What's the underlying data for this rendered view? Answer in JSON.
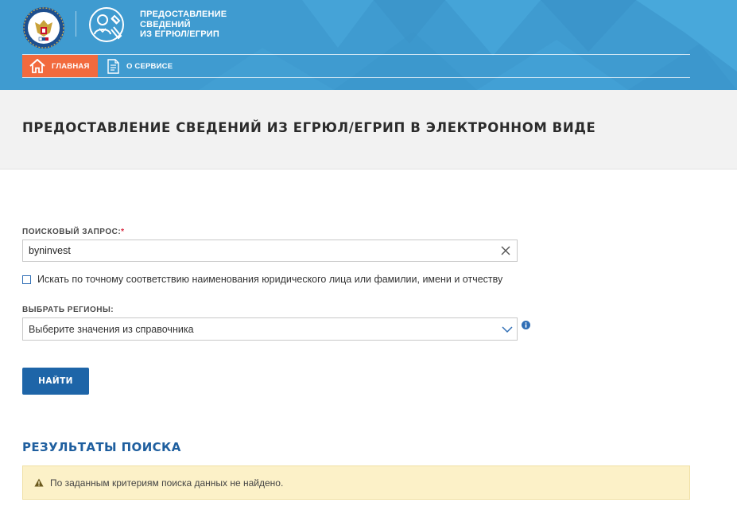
{
  "header": {
    "service_title_lines": [
      "ПРЕДОСТАВЛЕНИЕ",
      "СВЕДЕНИЙ",
      "ИЗ ЕГРЮЛ/ЕГРИП"
    ],
    "nav": {
      "home_label": "ГЛАВНАЯ",
      "about_label": "О СЕРВИСЕ",
      "active": "home"
    }
  },
  "page": {
    "title": "ПРЕДОСТАВЛЕНИЕ СВЕДЕНИЙ ИЗ ЕГРЮЛ/ЕГРИП В ЭЛЕКТРОННОМ ВИДЕ"
  },
  "form": {
    "query_label": "ПОИСКОВЫЙ ЗАПРОС:",
    "required_mark": "*",
    "query_value": "byninvest",
    "exact_match_label": "Искать по точному соответствию наименования юридического лица или фамилии, имени и отчеству",
    "exact_match_checked": false,
    "regions_label": "ВЫБРАТЬ РЕГИОНЫ:",
    "regions_placeholder": "Выберите значения из справочника",
    "submit_label": "НАЙТИ"
  },
  "results": {
    "title": "РЕЗУЛЬТАТЫ ПОИСКА",
    "message": "По заданным критериям поиска данных не найдено."
  },
  "icons": {
    "emblem": "fns-emblem-icon",
    "service": "service-person-wrench-icon",
    "home": "home-icon",
    "about": "document-icon",
    "clear": "close-icon",
    "dropdown": "chevron-down-icon",
    "info": "info-icon",
    "warning": "warning-icon"
  },
  "colors": {
    "header_blue": "#3f9bd0",
    "nav_active": "#f26a3d",
    "button_blue": "#1e65a8",
    "results_title": "#1f5f9f",
    "alert_bg": "#fcf1c8",
    "required": "#d7263d"
  }
}
